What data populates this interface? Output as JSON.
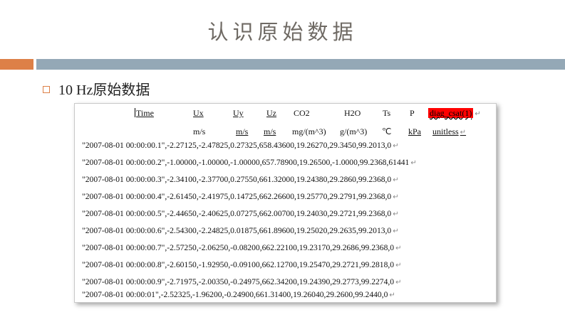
{
  "slide": {
    "title": "认识原始数据",
    "bullet": "10 Hz原始数据"
  },
  "header": {
    "columns": [
      "Time",
      "Ux",
      "Uy",
      "Uz",
      "CO2",
      "H2O",
      "Ts",
      "P",
      "diag_csat(1)"
    ],
    "units": [
      "m/s",
      "m/s",
      "m/s",
      "mg/(m^3)",
      "g/(m^3)",
      "℃",
      "kPa",
      "unitless"
    ]
  },
  "rows": [
    "\"2007-08-01 00:00:00.1\",-2.27125,-2.47825,0.27325,658.43600,19.26270,29.3450,99.2013,0",
    "\"2007-08-01 00:00:00.2\",-1.00000,-1.00000,-1.00000,657.78900,19.26500,-1.0000,99.2368,61441",
    "\"2007-08-01 00:00:00.3\",-2.34100,-2.37700,0.27550,661.32000,19.24380,29.2860,99.2368,0",
    "\"2007-08-01 00:00:00.4\",-2.61450,-2.41975,0.14725,662.26600,19.25770,29.2791,99.2368,0",
    "\"2007-08-01 00:00:00.5\",-2.44650,-2.40625,0.07275,662.00700,19.24030,29.2721,99.2368,0",
    "\"2007-08-01 00:00:00.6\",-2.54300,-2.24825,0.01875,661.89600,19.25020,29.2635,99.2013,0",
    "\"2007-08-01 00:00:00.7\",-2.57250,-2.06250,-0.08200,662.22100,19.23170,29.2686,99.2368,0",
    "\"2007-08-01 00:00:00.8\",-2.60150,-1.92950,-0.09100,662.12700,19.25470,29.2721,99.2818,0",
    "\"2007-08-01 00:00:00.9\",-2.71975,-2.00350,-0.24975,662.34200,19.24390,29.2773,99.2274,0",
    "\"2007-08-01 00:00:01\",-2.52325,-1.96200,-0.24900,661.31400,19.26040,29.2600,99.2440,0"
  ],
  "colors": {
    "accent_orange": "#dd8047",
    "accent_blue_gray": "#94a8b6",
    "highlight": "#ff0000"
  }
}
